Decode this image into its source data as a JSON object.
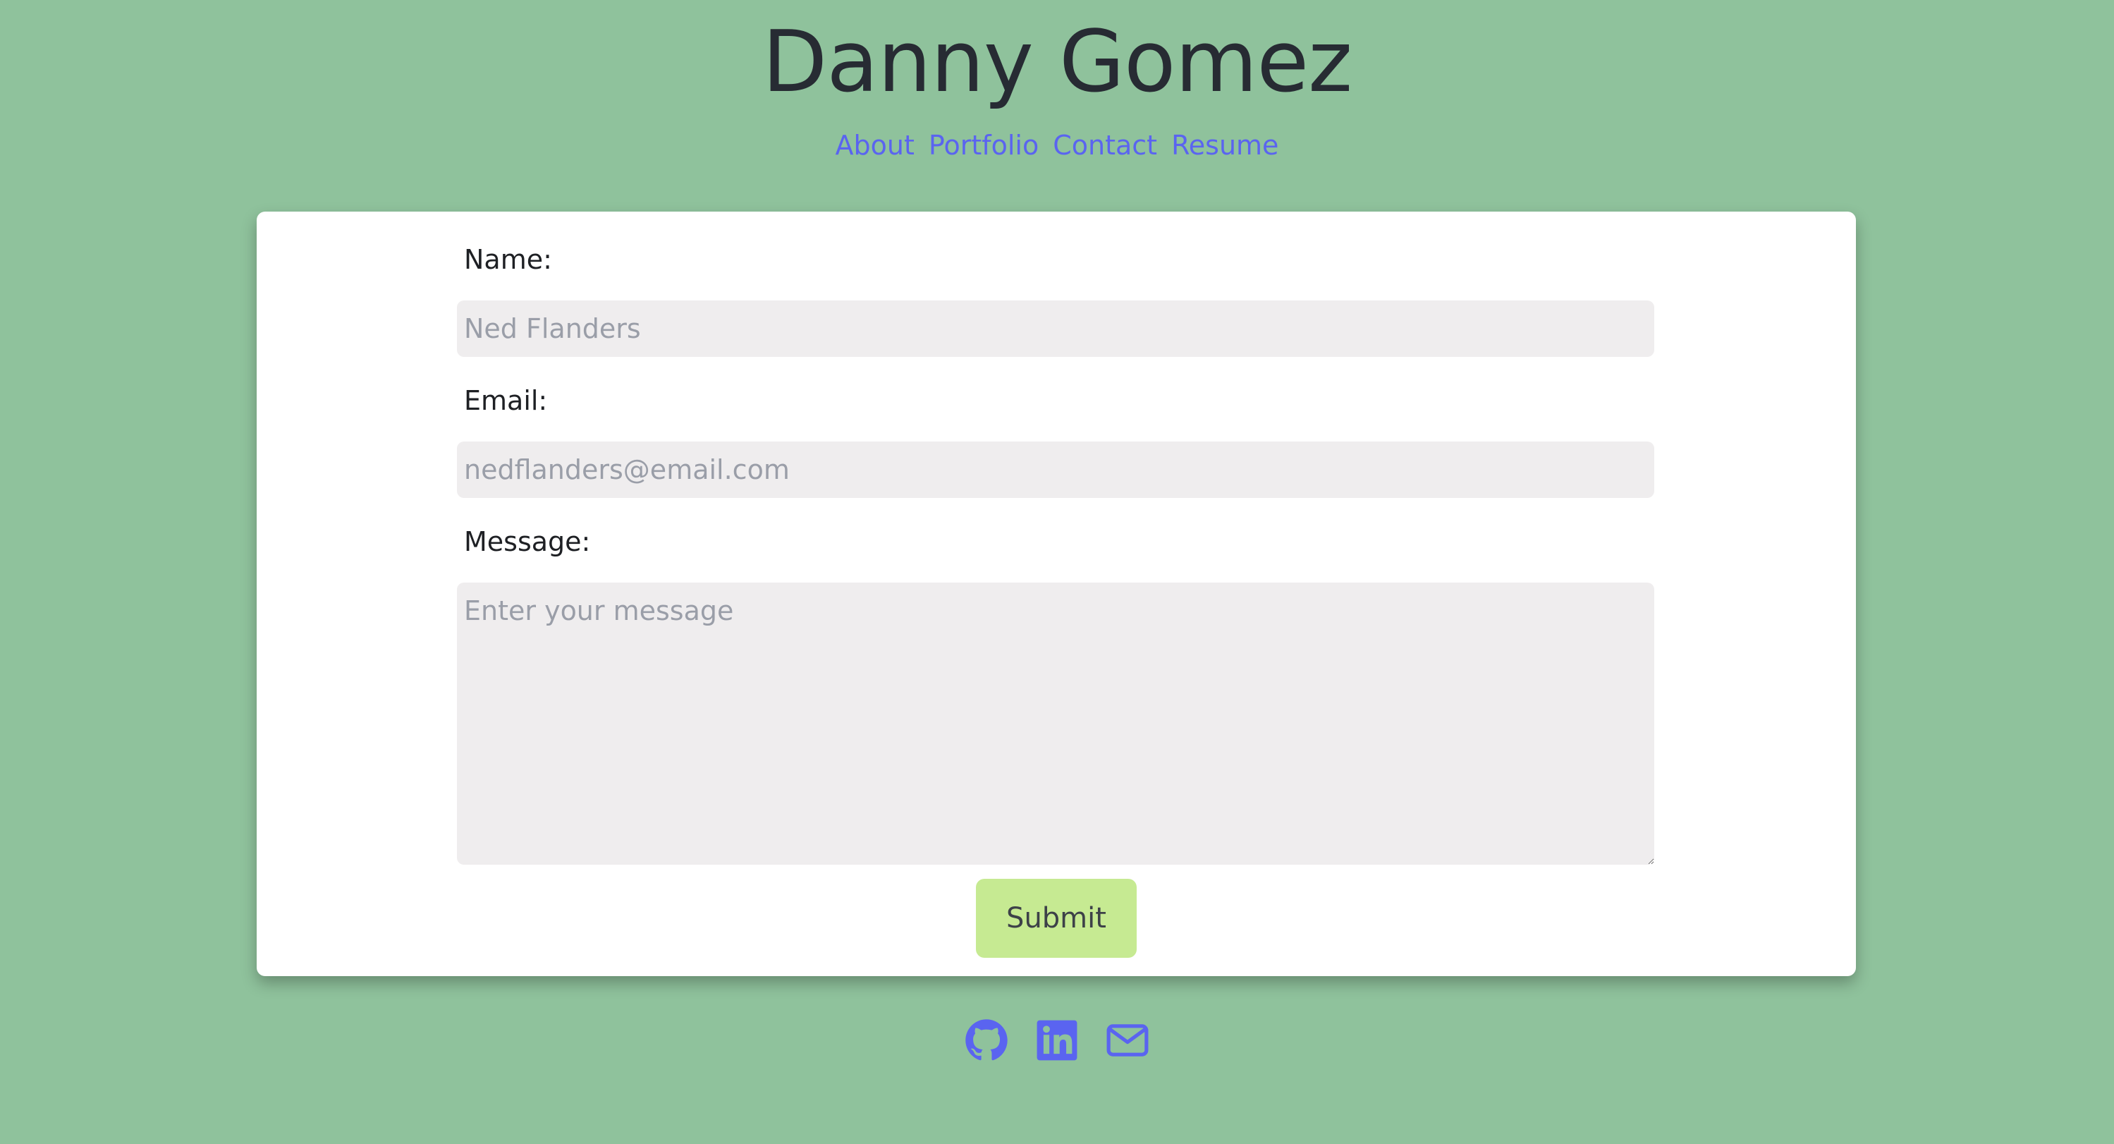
{
  "header": {
    "title": "Danny Gomez",
    "nav": [
      {
        "label": "About"
      },
      {
        "label": "Portfolio"
      },
      {
        "label": "Contact"
      },
      {
        "label": "Resume"
      }
    ]
  },
  "contact_form": {
    "name_label": "Name:",
    "name_placeholder": "Ned Flanders",
    "name_value": "",
    "email_label": "Email:",
    "email_placeholder": "nedflanders@email.com",
    "email_value": "",
    "message_label": "Message:",
    "message_placeholder": "Enter your message",
    "message_value": "",
    "submit_label": "Submit"
  },
  "footer": {
    "icons": [
      {
        "name": "github-icon"
      },
      {
        "name": "linkedin-icon"
      },
      {
        "name": "email-icon"
      }
    ]
  },
  "colors": {
    "background": "#8fc29c",
    "accent": "#5a64f0",
    "submit": "#c6ea92",
    "input_bg": "#efedee",
    "title": "#272b33"
  }
}
